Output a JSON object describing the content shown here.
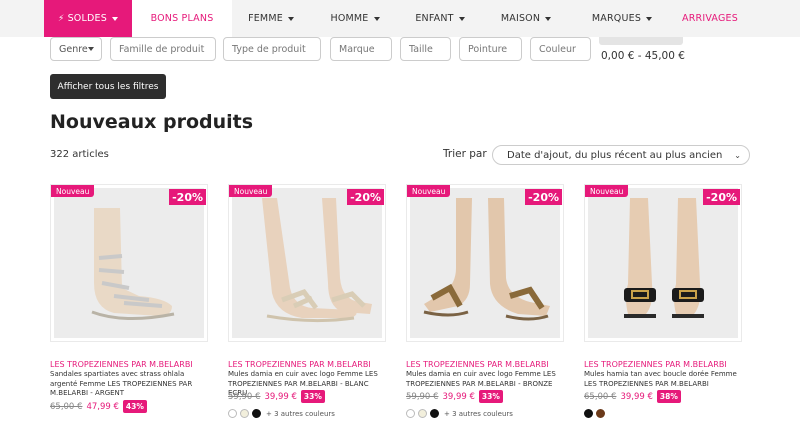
{
  "nav": {
    "soldes": "SOLDES",
    "bons_plans": "BONS PLANS",
    "femme": "FEMME",
    "homme": "HOMME",
    "enfant": "ENFANT",
    "maison": "MAISON",
    "marques": "MARQUES",
    "arrivages": "ARRIVAGES"
  },
  "filters": {
    "genre": "Genre",
    "famille": "Famille de produit",
    "type": "Type de produit",
    "marque": "Marque",
    "taille": "Taille",
    "pointure": "Pointure",
    "couleur": "Couleur",
    "price_range": "0,00 € - 45,00 €",
    "all_filters": "Afficher tous les filtres"
  },
  "listing": {
    "title": "Nouveaux produits",
    "count": "322 articles",
    "sort_label": "Trier par",
    "sort_value": "Date d'ajout, du plus récent au plus ancien"
  },
  "colors": {
    "accent": "#e6197a",
    "dark_button": "#2e2e2e"
  },
  "products": [
    {
      "badge_new": "Nouveau",
      "discount": "-20%",
      "brand": "LES TROPEZIENNES PAR M.BELARBI",
      "name": "Sandales spartiates avec strass ohlala argenté Femme LES TROPEZIENNES PAR M.BELARBI - ARGENT",
      "old_price": "65,00 €",
      "new_price": "47,99 €",
      "percent": "43%",
      "swatches": [],
      "more_colors": ""
    },
    {
      "badge_new": "Nouveau",
      "discount": "-20%",
      "brand": "LES TROPEZIENNES PAR M.BELARBI",
      "name": "Mules damia en cuir avec logo Femme LES TROPEZIENNES PAR M.BELARBI - BLANC ECRU",
      "old_price": "59,90 €",
      "new_price": "39,99 €",
      "percent": "33%",
      "swatches": [
        "#ffffff",
        "#f2efdc",
        "#111111"
      ],
      "more_colors": "+ 3 autres couleurs"
    },
    {
      "badge_new": "Nouveau",
      "discount": "-20%",
      "brand": "LES TROPEZIENNES PAR M.BELARBI",
      "name": "Mules damia en cuir avec logo Femme LES TROPEZIENNES PAR M.BELARBI - BRONZE",
      "old_price": "59,90 €",
      "new_price": "39,99 €",
      "percent": "33%",
      "swatches": [
        "#ffffff",
        "#f2efdc",
        "#111111"
      ],
      "more_colors": "+ 3 autres couleurs"
    },
    {
      "badge_new": "Nouveau",
      "discount": "-20%",
      "brand": "LES TROPEZIENNES PAR M.BELARBI",
      "name": "Mules hamia tan avec boucle dorée Femme LES TROPEZIENNES PAR M.BELARBI",
      "old_price": "65,00 €",
      "new_price": "39,99 €",
      "percent": "38%",
      "swatches": [
        "#111111",
        "#6b3a1a"
      ],
      "more_colors": ""
    }
  ]
}
